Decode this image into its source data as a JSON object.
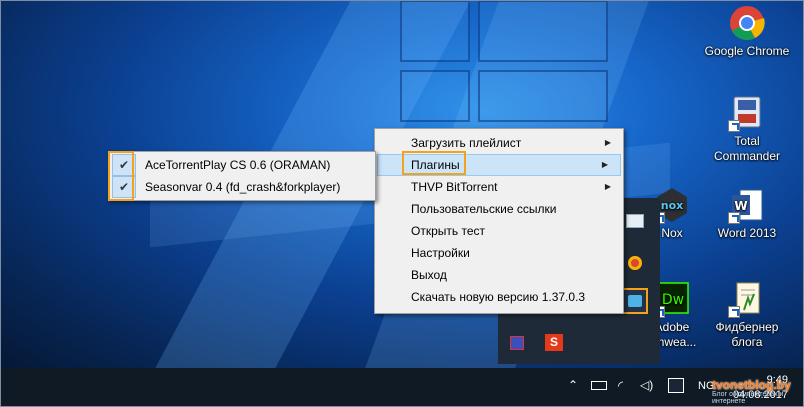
{
  "desktop": {
    "icons": [
      {
        "label": "Google Chrome",
        "icon": "chrome-icon"
      },
      {
        "label": "Total Commander",
        "icon": "total-commander-icon"
      },
      {
        "label": "Nox",
        "icon": "nox-icon"
      },
      {
        "label": "Word 2013",
        "icon": "word-icon"
      },
      {
        "label": "Adobe Dreamwea...",
        "icon": "dreamweaver-icon",
        "visible_label": "Adobe\namwea..."
      },
      {
        "label": "Фидбернер блога",
        "icon": "feedburner-icon"
      }
    ]
  },
  "menu": {
    "items": [
      {
        "label": "Загрузить плейлист",
        "has_submenu": true
      },
      {
        "label": "Плагины",
        "has_submenu": true,
        "active": true
      },
      {
        "label": "THVP BitTorrent",
        "has_submenu": true
      },
      {
        "label": "Пользовательские ссылки"
      },
      {
        "label": "Открыть тест"
      },
      {
        "label": "Настройки"
      },
      {
        "label": "Выход"
      },
      {
        "label": "Скачать новую версию 1.37.0.3"
      }
    ]
  },
  "submenu": {
    "items": [
      {
        "label": "AceTorrentPlay CS 0.6 (ORAMAN)",
        "checked": true
      },
      {
        "label": "Seasonvar 0.4 (fd_crash&forkplayer)",
        "checked": true
      }
    ]
  },
  "tray": {
    "hidden_icons": [
      "mail-icon",
      "chrome-icon",
      "app-tray-icon",
      "disk-icon",
      "sumatra-icon"
    ]
  },
  "taskbar": {
    "language": "NG",
    "time": "9:49",
    "date": "04.08.2017"
  },
  "watermark": {
    "text": "tvonetblog.by",
    "subtext": "Блог о компьютерах и интернете"
  },
  "colors": {
    "highlight": "#f3a21c",
    "menu_active": "#cce4f7",
    "taskbar": "#101a24"
  }
}
